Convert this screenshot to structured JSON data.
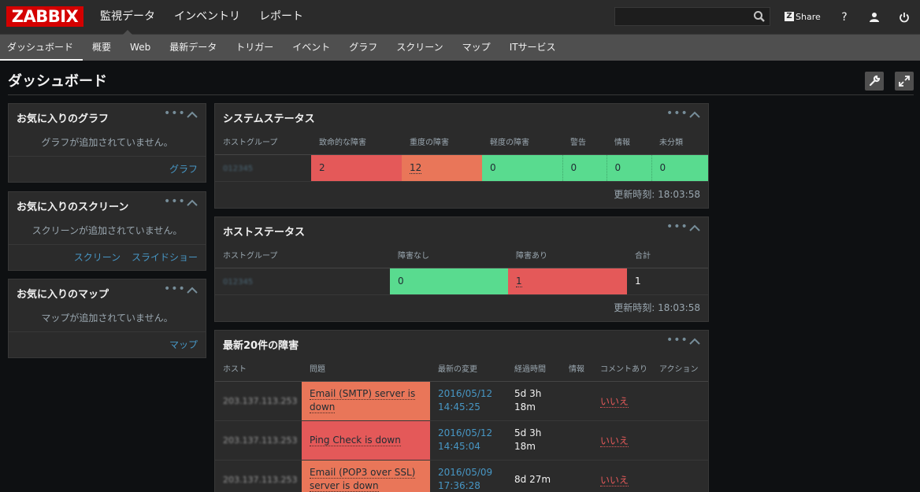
{
  "logo": {
    "text": "ZABBIX",
    "color": "#d40000"
  },
  "main_nav": [
    {
      "label": "監視データ",
      "active": true
    },
    {
      "label": "インベントリ",
      "active": false
    },
    {
      "label": "レポート",
      "active": false
    }
  ],
  "search": {
    "value": "",
    "placeholder": ""
  },
  "topbar": {
    "share_label": "Share",
    "help_icon": "help-icon",
    "user_icon": "user-icon",
    "logout_icon": "power-icon"
  },
  "sub_nav": [
    {
      "label": "ダッシュボード",
      "active": true
    },
    {
      "label": "概要",
      "active": false
    },
    {
      "label": "Web",
      "active": false
    },
    {
      "label": "最新データ",
      "active": false
    },
    {
      "label": "トリガー",
      "active": false
    },
    {
      "label": "イベント",
      "active": false
    },
    {
      "label": "グラフ",
      "active": false
    },
    {
      "label": "スクリーン",
      "active": false
    },
    {
      "label": "マップ",
      "active": false
    },
    {
      "label": "ITサービス",
      "active": false
    }
  ],
  "page": {
    "title": "ダッシュボード"
  },
  "fav_graphs": {
    "title": "お気に入りのグラフ",
    "empty": "グラフが追加されていません。",
    "links": [
      "グラフ"
    ]
  },
  "fav_screens": {
    "title": "お気に入りのスクリーン",
    "empty": "スクリーンが追加されていません。",
    "links": [
      "スクリーン",
      "スライドショー"
    ]
  },
  "fav_maps": {
    "title": "お気に入りのマップ",
    "empty": "マップが追加されていません。",
    "links": [
      "マップ"
    ]
  },
  "system_status": {
    "title": "システムステータス",
    "headers": [
      "ホストグループ",
      "致命的な障害",
      "重度の障害",
      "軽度の障害",
      "警告",
      "情報",
      "未分類"
    ],
    "rows": [
      {
        "group": "012345",
        "disaster": "2",
        "high": "12",
        "average": "0",
        "warning": "0",
        "info": "0",
        "nc": "0"
      }
    ],
    "updated": "更新時刻: 18:03:58"
  },
  "host_status": {
    "title": "ホストステータス",
    "headers": [
      "ホストグループ",
      "障害なし",
      "障害あり",
      "合計"
    ],
    "rows": [
      {
        "group": "012345",
        "without": "0",
        "with": "1",
        "total": "1"
      }
    ],
    "updated": "更新時刻: 18:03:58"
  },
  "last_issues": {
    "title": "最新20件の障害",
    "headers": [
      "ホスト",
      "問題",
      "最新の変更",
      "経過時間",
      "情報",
      "コメントあり",
      "アクション"
    ],
    "rows": [
      {
        "host": "203.137.113.253",
        "issue_l1": "Email (SMTP) server is",
        "issue_l2": "down",
        "date": "2016/05/12",
        "time": "14:45:25",
        "age_l1": "5d 3h",
        "age_l2": "18m",
        "ack": "いいえ",
        "color": "#e97659"
      },
      {
        "host": "203.137.113.253",
        "issue_l1": "Ping Check is down",
        "issue_l2": "",
        "date": "2016/05/12",
        "time": "14:45:04",
        "age_l1": "5d 3h",
        "age_l2": "18m",
        "ack": "いいえ",
        "color": "#e45959"
      },
      {
        "host": "203.137.113.253",
        "issue_l1": "Email (POP3 over SSL)",
        "issue_l2": "server is down",
        "date": "2016/05/09",
        "time": "17:36:28",
        "age_l1": "8d 27m",
        "age_l2": "",
        "ack": "いいえ",
        "color": "#e97659"
      }
    ]
  },
  "widget_controls": {
    "more_icon": "more-dots-icon",
    "collapse_icon": "chevron-up-icon"
  },
  "colors": {
    "disaster": "#e45959",
    "high": "#e97659",
    "ok": "#59db8f",
    "link": "#4796c4"
  }
}
